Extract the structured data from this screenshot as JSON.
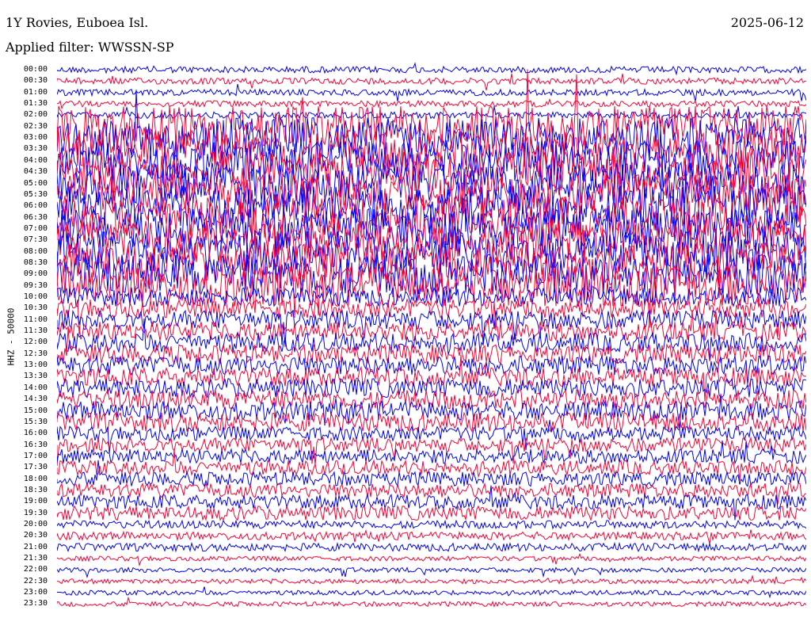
{
  "header": {
    "station": "1Y Rovies, Euboea Isl.",
    "date": "2025-06-12",
    "filter": "Applied filter: WWSSN-SP"
  },
  "channel_label": "HHZ - 50000",
  "trace_colors": [
    "#0000ff",
    "#ff0033"
  ],
  "row_labels": [
    "00:00",
    "00:30",
    "01:00",
    "01:30",
    "02:00",
    "02:30",
    "03:00",
    "03:30",
    "04:00",
    "04:30",
    "05:00",
    "05:30",
    "06:00",
    "06:30",
    "07:00",
    "07:30",
    "08:00",
    "08:30",
    "09:00",
    "09:30",
    "10:00",
    "10:30",
    "11:00",
    "11:30",
    "12:00",
    "12:30",
    "13:00",
    "13:30",
    "14:00",
    "14:30",
    "15:00",
    "15:30",
    "16:00",
    "16:30",
    "17:00",
    "17:30",
    "18:00",
    "18:30",
    "19:00",
    "19:30",
    "20:00",
    "20:30",
    "21:00",
    "21:30",
    "22:00",
    "22:30",
    "23:00",
    "23:30"
  ]
}
